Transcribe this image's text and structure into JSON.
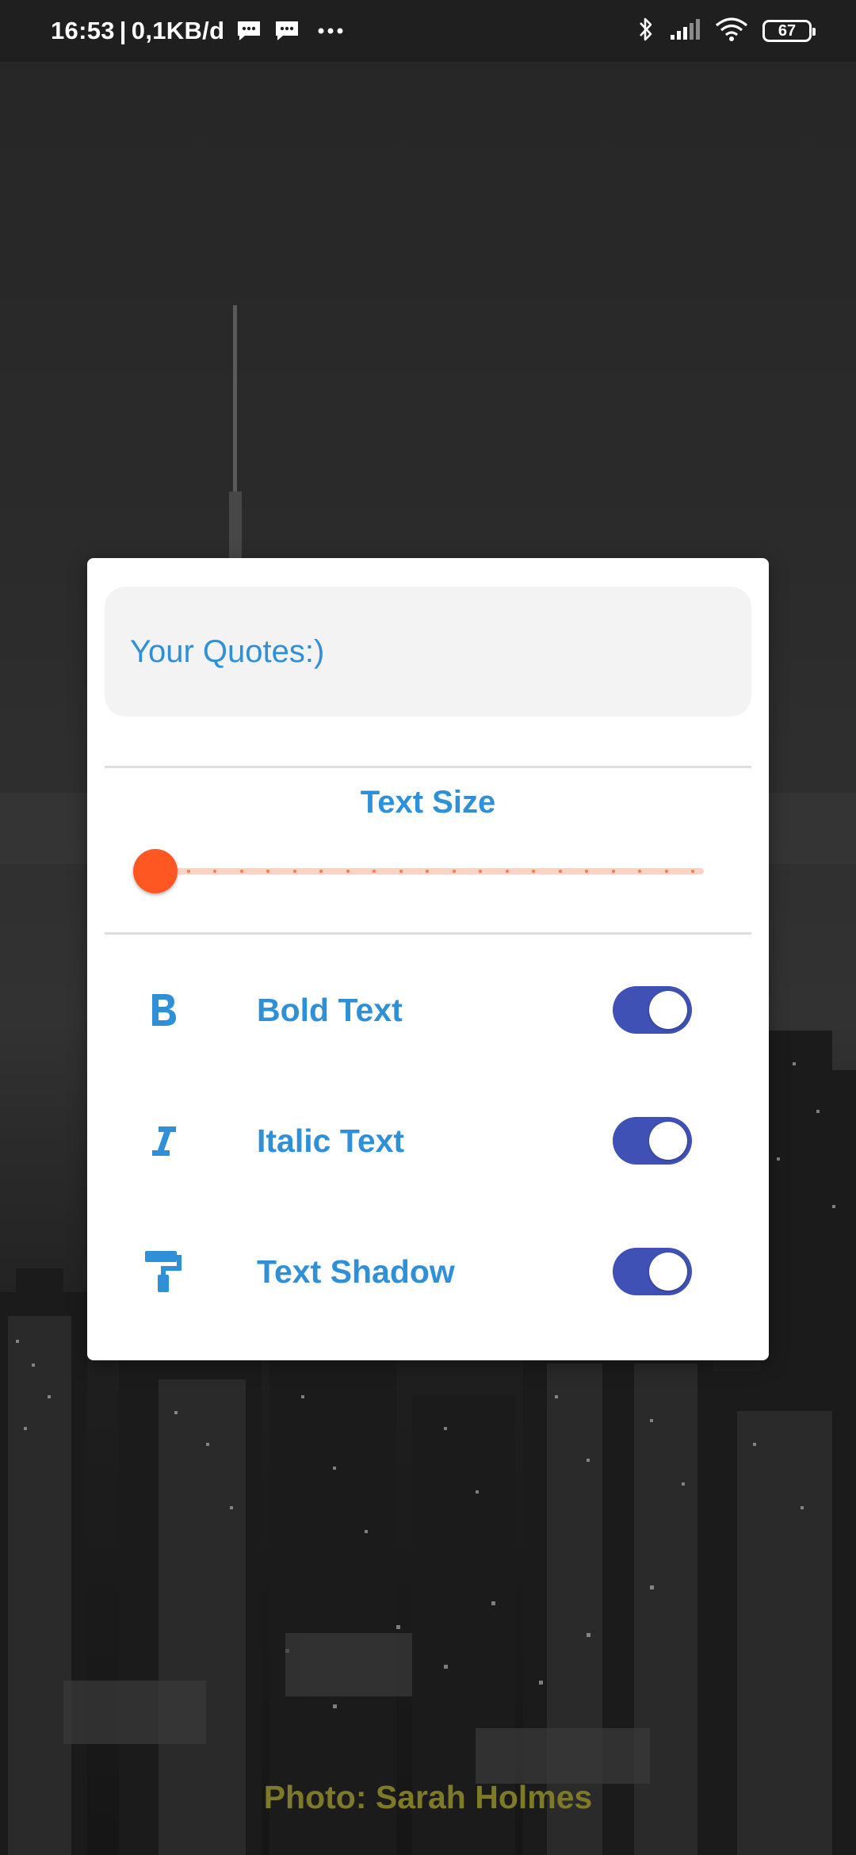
{
  "status_bar": {
    "time": "16:53",
    "separator": "|",
    "data_rate": "0,1KB/d",
    "battery": "67"
  },
  "card": {
    "quote_input": {
      "value": "Your Quotes:)"
    },
    "text_size": {
      "title": "Text Size",
      "value_fraction": 0.0
    },
    "options": [
      {
        "icon": "bold-icon",
        "label": "Bold Text",
        "enabled": true
      },
      {
        "icon": "italic-icon",
        "label": "Italic Text",
        "enabled": true
      },
      {
        "icon": "paint-roller-icon",
        "label": "Text Shadow",
        "enabled": true
      }
    ]
  },
  "photo_credit": "Photo: Sarah Holmes",
  "colors": {
    "accent_text": "#2f90d8",
    "slider_thumb": "#ff5722",
    "slider_track": "#ffd3c4",
    "toggle_on": "#3f51b5",
    "credit_text": "#7d7a2a"
  }
}
